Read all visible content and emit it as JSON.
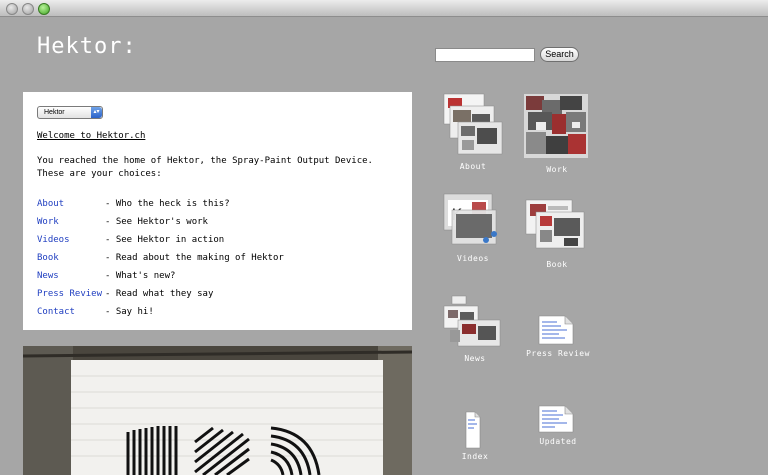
{
  "site": {
    "title": "Hektor:"
  },
  "search": {
    "placeholder": "",
    "value": "",
    "button_label": "Search"
  },
  "panel": {
    "select_value": "Hektor",
    "welcome": "Welcome to Hektor.ch",
    "intro_line1": "You reached the home of Hektor, the Spray-Paint Output Device.",
    "intro_line2": "These are your choices:",
    "menu": [
      {
        "label": "About",
        "desc": "- Who the heck is this?"
      },
      {
        "label": "Work",
        "desc": "- See Hektor's work"
      },
      {
        "label": "Videos",
        "desc": "- See Hektor in action"
      },
      {
        "label": "Book",
        "desc": "- Read about the making of Hektor"
      },
      {
        "label": "News",
        "desc": "- What's new?"
      },
      {
        "label": "Press Review",
        "desc": "- Read what they say"
      },
      {
        "label": "Contact",
        "desc": "- Say hi!"
      }
    ]
  },
  "icons": [
    {
      "label": "About",
      "icon": "about-screenshots-icon"
    },
    {
      "label": "Work",
      "icon": "work-screenshots-icon"
    },
    {
      "label": "Videos",
      "icon": "videos-screenshots-icon"
    },
    {
      "label": "Book",
      "icon": "book-screenshots-icon"
    },
    {
      "label": "News",
      "icon": "news-screenshots-icon"
    },
    {
      "label": "Press Review",
      "icon": "document-icon"
    },
    {
      "label": "Index",
      "icon": "document-icon"
    },
    {
      "label": "Updated",
      "icon": "document-icon"
    }
  ],
  "colors": {
    "background": "#a6a6a6",
    "link": "#1f3ec0",
    "panel": "#ffffff"
  }
}
